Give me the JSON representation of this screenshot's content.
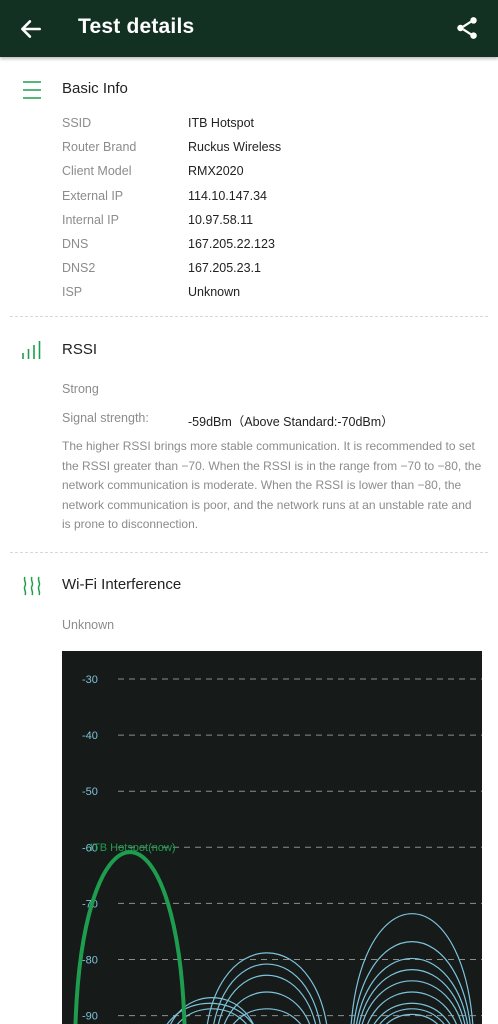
{
  "header": {
    "title": "Test details",
    "back_icon": "arrow-left-icon",
    "share_icon": "share-icon",
    "bg_color": "#133122"
  },
  "basic_info": {
    "title": "Basic Info",
    "icon": "menu-lines-icon",
    "rows": [
      {
        "key": "SSID",
        "value": "ITB Hotspot"
      },
      {
        "key": "Router Brand",
        "value": "Ruckus Wireless"
      },
      {
        "key": "Client Model",
        "value": "RMX2020"
      },
      {
        "key": "External IP",
        "value": "114.10.147.34"
      },
      {
        "key": "Internal IP",
        "value": "10.97.58.11"
      },
      {
        "key": "DNS",
        "value": "167.205.22.123"
      },
      {
        "key": "DNS2",
        "value": "167.205.23.1"
      },
      {
        "key": "ISP",
        "value": "Unknown"
      }
    ]
  },
  "rssi": {
    "title": "RSSI",
    "icon": "signal-bars-icon",
    "level": "Strong",
    "signal_key": "Signal strength:",
    "signal_value": "-59dBm（Above Standard:-70dBm）",
    "description": "The higher RSSI brings more stable communication. It is recommended to set the RSSI greater than −70. When the RSSI is in the range from −70 to −80, the network communication is moderate. When the RSSI is lower than −80, the network communication is poor, and the network runs at an unstable rate and is prone to disconnection."
  },
  "wifi_interference": {
    "title": "Wi-Fi Interference",
    "icon": "wifi-waves-icon",
    "status": "Unknown"
  },
  "chart_data": {
    "type": "area",
    "y_ticks": [
      "-30",
      "-40",
      "-50",
      "-60",
      "-70",
      "-80",
      "-90"
    ],
    "ylim": [
      -90,
      -30
    ],
    "grid": true,
    "accent_color": "#1f9d4e",
    "other_color": "#7ec3dc",
    "current_network": {
      "name": "ITB Hotspot(now)",
      "peak": -59
    },
    "other_networks": [
      {
        "peak": -85
      },
      {
        "peak": -86
      },
      {
        "peak": -87
      },
      {
        "peak": -77
      },
      {
        "peak": -79
      },
      {
        "peak": -81
      },
      {
        "peak": -84
      },
      {
        "peak": -87
      },
      {
        "peak": -70
      },
      {
        "peak": -75
      },
      {
        "peak": -78
      },
      {
        "peak": -80
      },
      {
        "peak": -82
      },
      {
        "peak": -84
      },
      {
        "peak": -86
      },
      {
        "peak": -87
      },
      {
        "peak": -88
      }
    ]
  }
}
